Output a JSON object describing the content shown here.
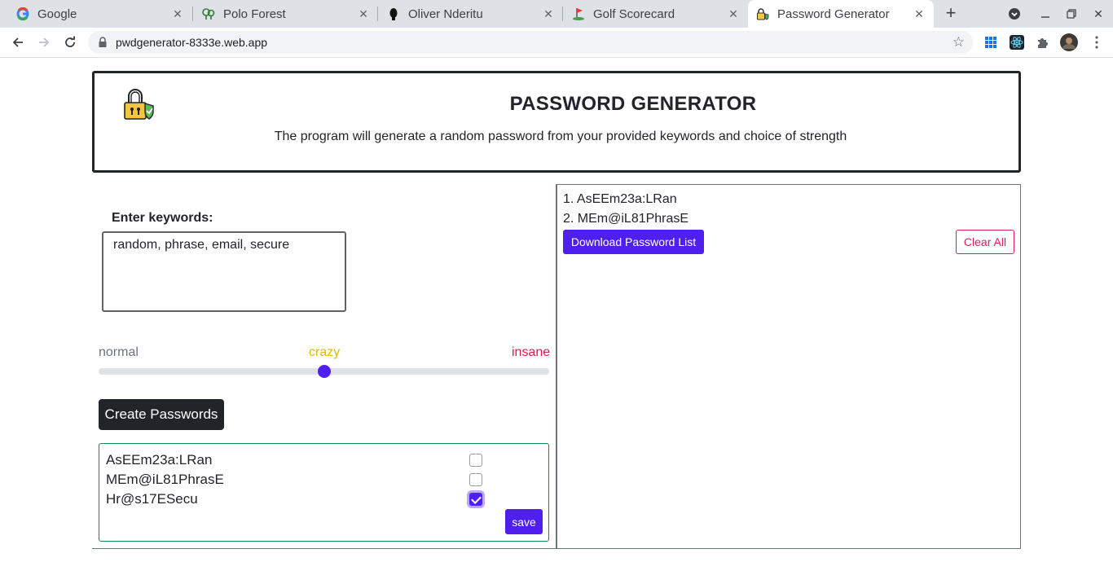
{
  "browser": {
    "tabs": [
      {
        "title": "Google",
        "icon": "google-icon"
      },
      {
        "title": "Polo Forest",
        "icon": "trees-icon"
      },
      {
        "title": "Oliver Nderitu",
        "icon": "silhouette-icon"
      },
      {
        "title": "Golf Scorecard",
        "icon": "golf-icon"
      },
      {
        "title": "Password Generator",
        "icon": "padlock-icon",
        "active": true
      }
    ],
    "url": "pwdgenerator-8333e.web.app"
  },
  "header": {
    "title": "PASSWORD GENERATOR",
    "subtitle": "The program will generate a random password from your provided keywords and choice of strength"
  },
  "form": {
    "keywords_label": "Enter keywords:",
    "keywords_value": "random, phrase, email, secure",
    "strength_levels": [
      {
        "label": "normal",
        "color": "#6c757d"
      },
      {
        "label": "crazy",
        "color": "#e6b800"
      },
      {
        "label": "insane",
        "color": "#d6204f"
      }
    ],
    "strength_value": 0.5,
    "create_label": "Create Passwords"
  },
  "results": {
    "items": [
      {
        "password": "AsEEm23a:LRan",
        "checked": false
      },
      {
        "password": "MEm@iL81PhrasE",
        "checked": false
      },
      {
        "password": "Hr@s17ESecu",
        "checked": true
      }
    ],
    "save_label": "save"
  },
  "saved_list": {
    "items": [
      "1. AsEEm23a:LRan",
      "2. MEm@iL81PhrasE"
    ],
    "download_label": "Download Password List",
    "clear_label": "Clear All"
  },
  "colors": {
    "accent": "#4f1ff0",
    "dark": "#212529",
    "danger": "#dc1f5a",
    "success_border": "#198754"
  }
}
